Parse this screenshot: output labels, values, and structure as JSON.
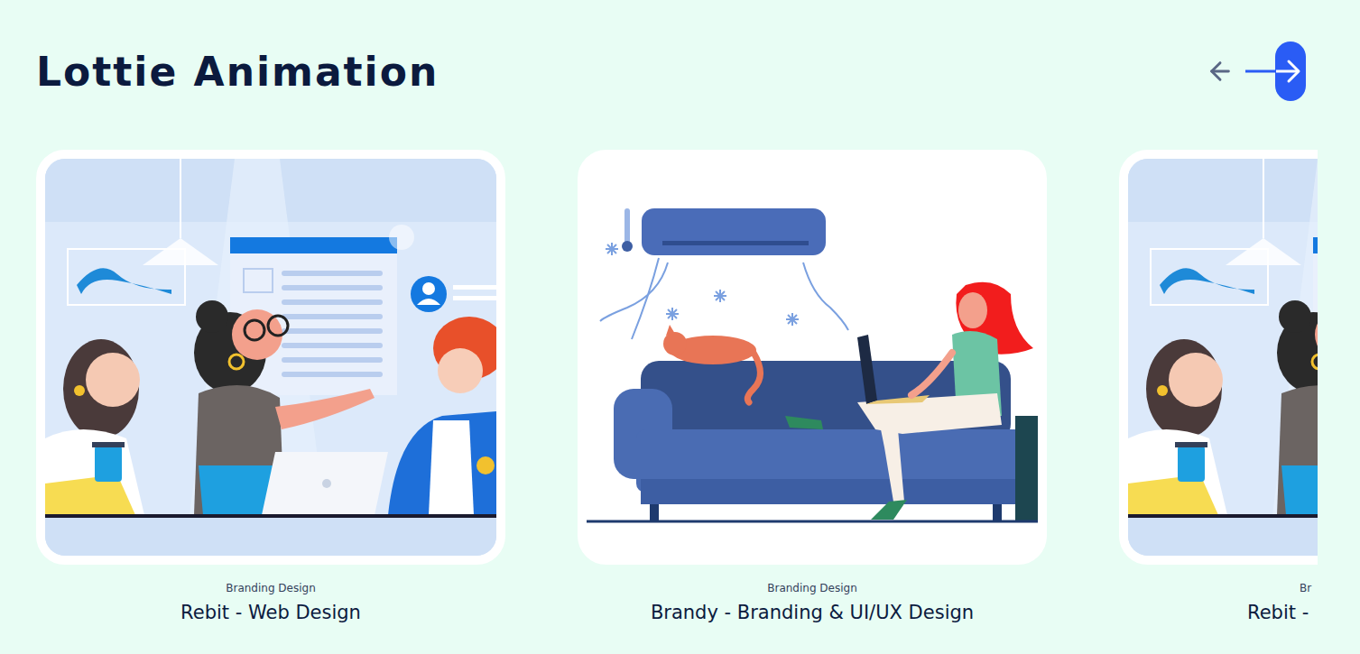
{
  "section": {
    "title": "Lottie Animation"
  },
  "nav": [
    {
      "kind": "prev",
      "active": false
    },
    {
      "kind": "next",
      "active": true
    }
  ],
  "cards": [
    {
      "kind": "team",
      "category": "Branding Design",
      "title": "Rebit - Web Design"
    },
    {
      "kind": "sofa",
      "category": "Branding Design",
      "title": "Brandy - Branding & UI/UX Design"
    },
    {
      "kind": "team",
      "category": "Br",
      "title": "Rebit -"
    }
  ]
}
